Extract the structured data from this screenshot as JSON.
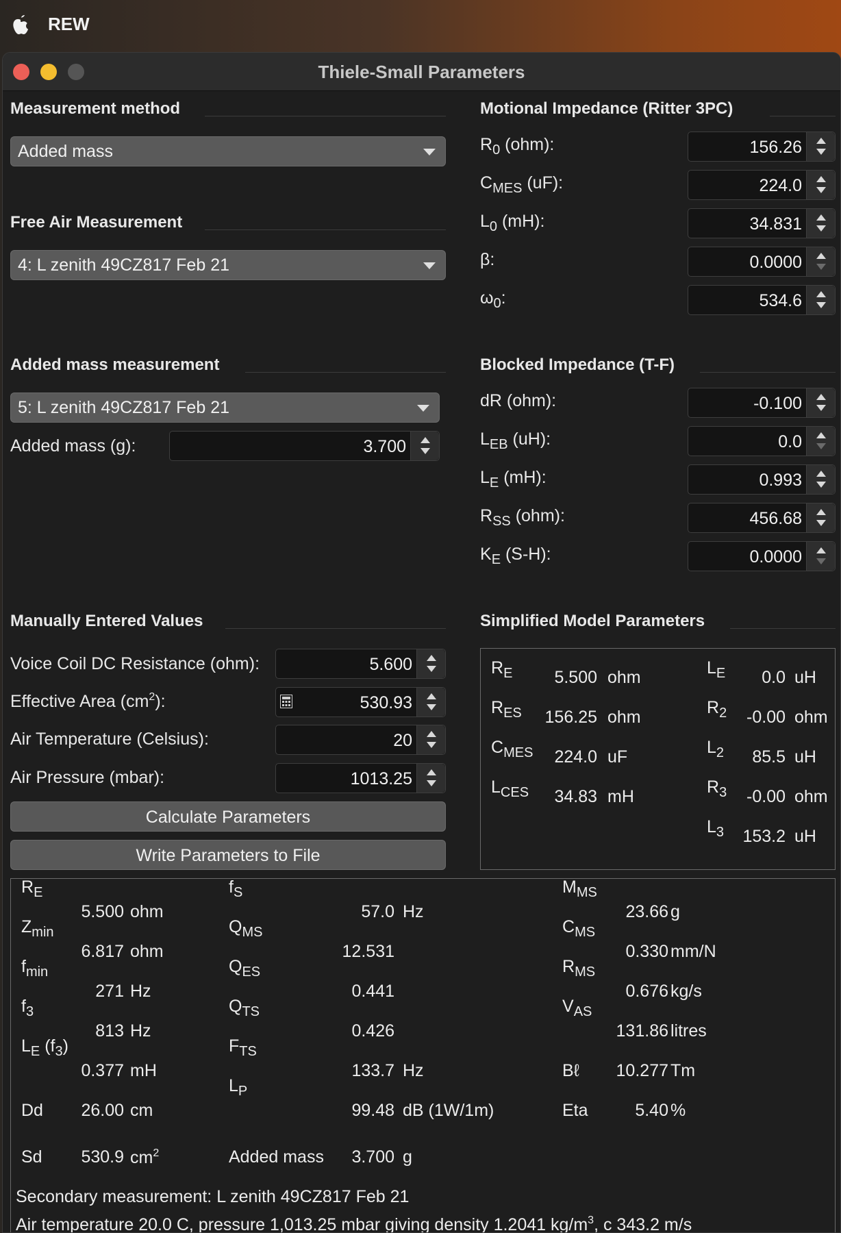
{
  "menubar": {
    "app_name": "REW"
  },
  "window": {
    "title": "Thiele-Small Parameters"
  },
  "left": {
    "measurement_method": {
      "title": "Measurement method",
      "selected": "Added mass"
    },
    "free_air": {
      "title": "Free Air Measurement",
      "selected": "4: L zenith 49CZ817 Feb 21"
    },
    "added_mass": {
      "title": "Added mass measurement",
      "selected": "5: L zenith 49CZ817 Feb 21",
      "mass_label": "Added mass (g):",
      "mass_value": "3.700"
    },
    "manual": {
      "title": "Manually Entered Values",
      "fields": [
        {
          "label": "Voice Coil DC Resistance (ohm):",
          "value": "5.600"
        },
        {
          "label_pre": "Effective Area (cm",
          "label_sup": "2",
          "label_post": "):",
          "value": "530.93"
        },
        {
          "label": "Air Temperature (Celsius):",
          "value": "20"
        },
        {
          "label": "Air Pressure (mbar):",
          "value": "1013.25"
        }
      ],
      "calculate_label": "Calculate Parameters",
      "write_label": "Write Parameters to File"
    }
  },
  "right": {
    "motional": {
      "title": "Motional Impedance (Ritter 3PC)",
      "fields": [
        {
          "main": "R",
          "sub": "0",
          "suffix": " (ohm):",
          "value": "156.26"
        },
        {
          "main": "C",
          "sub": "MES",
          "suffix": " (uF):",
          "value": "224.0"
        },
        {
          "main": "L",
          "sub": "0",
          "suffix": " (mH):",
          "value": "34.831"
        },
        {
          "main": "β",
          "sub": "",
          "suffix": ":",
          "value": "0.0000"
        },
        {
          "main": "ω",
          "sub": "0",
          "suffix": ":",
          "value": "534.6"
        }
      ]
    },
    "blocked": {
      "title": "Blocked Impedance (T-F)",
      "fields": [
        {
          "main": "dR (ohm):",
          "sub": "",
          "suffix": "",
          "value": "-0.100"
        },
        {
          "main": "L",
          "sub": "EB",
          "suffix": " (uH):",
          "value": "0.0"
        },
        {
          "main": "L",
          "sub": "E",
          "suffix": " (mH):",
          "value": "0.993"
        },
        {
          "main": "R",
          "sub": "SS",
          "suffix": " (ohm):",
          "value": "456.68"
        },
        {
          "main": "K",
          "sub": "E",
          "suffix": " (S-H):",
          "value": "0.0000"
        }
      ]
    },
    "simplified": {
      "title": "Simplified Model Parameters",
      "left_rows": [
        {
          "sym": "R",
          "sub": "E",
          "value": "5.500",
          "unit": "ohm"
        },
        {
          "sym": "R",
          "sub": "ES",
          "value": "156.25",
          "unit": "ohm"
        },
        {
          "sym": "C",
          "sub": "MES",
          "value": "224.0",
          "unit": "uF"
        },
        {
          "sym": "L",
          "sub": "CES",
          "value": "34.83",
          "unit": "mH"
        }
      ],
      "right_rows": [
        {
          "sym": "L",
          "sub": "E",
          "value": "0.0",
          "unit": "uH"
        },
        {
          "sym": "R",
          "sub": "2",
          "value": "-0.00",
          "unit": "ohm"
        },
        {
          "sym": "L",
          "sub": "2",
          "value": "85.5",
          "unit": "uH"
        },
        {
          "sym": "R",
          "sub": "3",
          "value": "-0.00",
          "unit": "ohm"
        },
        {
          "sym": "L",
          "sub": "3",
          "value": "153.2",
          "unit": "uH"
        }
      ]
    }
  },
  "results": {
    "col1": [
      {
        "sym": "R",
        "sub": "E",
        "extra": "",
        "value": "5.500",
        "unit": "ohm"
      },
      {
        "sym": "Z",
        "sub": "min",
        "extra": "",
        "value": "6.817",
        "unit": "ohm"
      },
      {
        "sym": "f",
        "sub": "min",
        "extra": "",
        "value": "271",
        "unit": "Hz"
      },
      {
        "sym": "f",
        "sub": "3",
        "extra": "",
        "value": "813",
        "unit": "Hz"
      },
      {
        "sym": "L",
        "sub": "E",
        "extra": " (f",
        "extra_sub": "3",
        "extra_post": ")",
        "value": "0.377",
        "unit": "mH"
      },
      {
        "sym": "Dd",
        "sub": "",
        "extra": "",
        "value": "26.00",
        "unit": "cm"
      },
      {
        "sym": "Sd",
        "sub": "",
        "extra": "",
        "value": "530.9",
        "unit": "cm",
        "unit_sup": "2"
      }
    ],
    "col2": [
      {
        "sym": "f",
        "sub": "S",
        "value": "57.0",
        "unit": "Hz"
      },
      {
        "sym": "Q",
        "sub": "MS",
        "value": "12.531",
        "unit": ""
      },
      {
        "sym": "Q",
        "sub": "ES",
        "value": "0.441",
        "unit": ""
      },
      {
        "sym": "Q",
        "sub": "TS",
        "value": "0.426",
        "unit": ""
      },
      {
        "sym": "F",
        "sub": "TS",
        "value": "133.7",
        "unit": "Hz"
      },
      {
        "sym": "L",
        "sub": "P",
        "value": "99.48",
        "unit": "dB (1W/1m)"
      },
      {
        "sym": "Added mass",
        "sub": "",
        "value": "3.700",
        "unit": "g"
      }
    ],
    "col3": [
      {
        "sym": "M",
        "sub": "MS",
        "value": "23.66",
        "unit": "g"
      },
      {
        "sym": "C",
        "sub": "MS",
        "value": "0.330",
        "unit": "mm/N"
      },
      {
        "sym": "R",
        "sub": "MS",
        "value": "0.676",
        "unit": "kg/s"
      },
      {
        "sym": "V",
        "sub": "AS",
        "value": "131.86",
        "unit": "litres"
      },
      {
        "sym": "Bℓ",
        "sub": "",
        "value": "10.277",
        "unit": "Tm"
      },
      {
        "sym": "Eta",
        "sub": "",
        "value": "5.40",
        "unit": "%"
      }
    ],
    "secondary": "Secondary measurement: L zenith 49CZ817 Feb 21",
    "air_pre": "Air temperature 20.0 C, pressure 1,013.25 mbar giving density 1.2041 kg/m",
    "air_sup": "3",
    "air_post": ", c 343.2 m/s"
  }
}
